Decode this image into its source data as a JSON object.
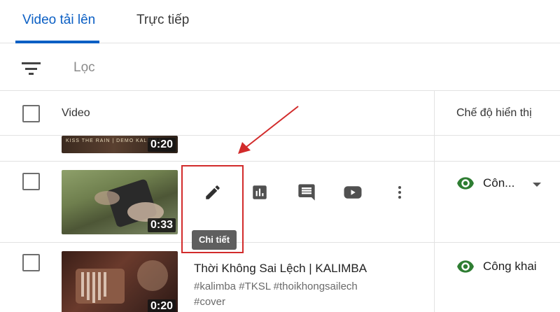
{
  "tabs": [
    {
      "label": "Video tải lên",
      "active": true
    },
    {
      "label": "Trực tiếp",
      "active": false
    }
  ],
  "filter": {
    "label": "Lọc",
    "icon": "filter-icon"
  },
  "table_header": {
    "video": "Video",
    "visibility": "Chế độ hiển thị"
  },
  "rows": [
    {
      "thumb_text": "KISS THE RAIN | DEMO KALIMBA",
      "duration": "0:20"
    },
    {
      "duration": "0:33",
      "actions": [
        "edit-icon",
        "analytics-icon",
        "comments-icon",
        "youtube-icon",
        "more-vert-icon"
      ],
      "tooltip": "Chi tiết",
      "visibility": "Côn...",
      "visibility_icon": "eye-icon"
    },
    {
      "duration": "0:20",
      "title": "Thời Không Sai Lệch | KALIMBA",
      "description_line1": "#kalimba #TKSL #thoikhongsailech",
      "description_line2": "#cover",
      "visibility": "Công khai",
      "visibility_icon": "eye-icon"
    }
  ],
  "colors": {
    "accent": "#0b5fc4",
    "highlight": "#d22b2b",
    "visibility_green": "#2e7d32",
    "tooltip_bg": "#5f5f5f"
  }
}
